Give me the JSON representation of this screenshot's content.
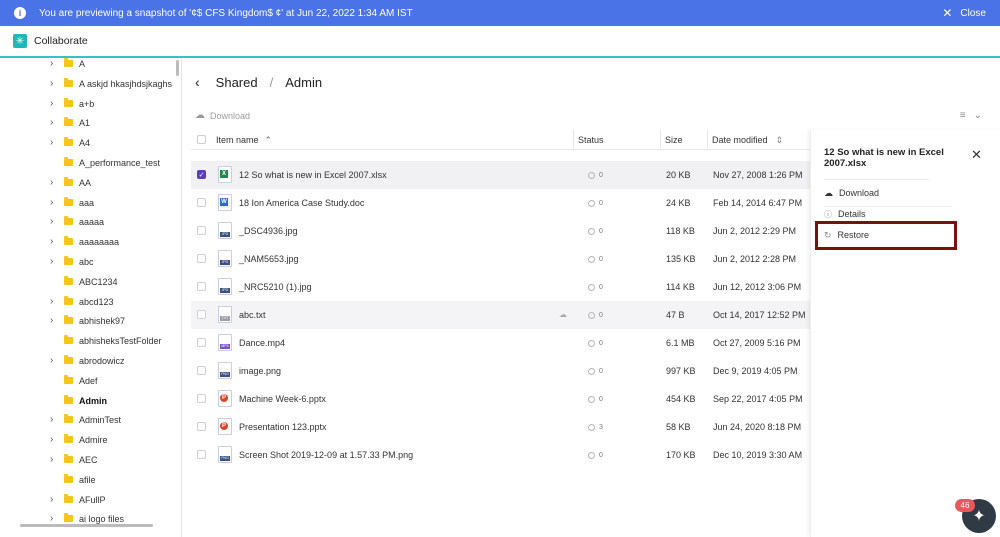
{
  "banner": {
    "message": "You are previewing a snapshot of '¢$ CFS Kingdom$ ¢' at Jun 22, 2022 1:34 AM IST",
    "close_label": "Close"
  },
  "app": {
    "title": "Collaborate"
  },
  "tree": {
    "items": [
      {
        "label": "A",
        "expandable": true
      },
      {
        "label": "A askjd hkasjhdsjkaghs",
        "expandable": true
      },
      {
        "label": "a+b",
        "expandable": true
      },
      {
        "label": "A1",
        "expandable": true
      },
      {
        "label": "A4",
        "expandable": true
      },
      {
        "label": "A_performance_test",
        "expandable": false
      },
      {
        "label": "AA",
        "expandable": true
      },
      {
        "label": "aaa",
        "expandable": true
      },
      {
        "label": "aaaaa",
        "expandable": true
      },
      {
        "label": "aaaaaaaa",
        "expandable": true
      },
      {
        "label": "abc",
        "expandable": true
      },
      {
        "label": "ABC1234",
        "expandable": false
      },
      {
        "label": "abcd123",
        "expandable": true
      },
      {
        "label": "abhishek97",
        "expandable": true
      },
      {
        "label": "abhisheksTestFolder",
        "expandable": false
      },
      {
        "label": "abrodowicz",
        "expandable": true
      },
      {
        "label": "Adef",
        "expandable": false
      },
      {
        "label": "Admin",
        "expandable": false,
        "active": true
      },
      {
        "label": "AdminTest",
        "expandable": true
      },
      {
        "label": "Admire",
        "expandable": true
      },
      {
        "label": "AEC",
        "expandable": true
      },
      {
        "label": "afile",
        "expandable": false
      },
      {
        "label": "AFullP",
        "expandable": true
      },
      {
        "label": "ai logo files",
        "expandable": true
      }
    ]
  },
  "breadcrumb": {
    "root": "Shared",
    "separator": "/",
    "current": "Admin"
  },
  "toolbar": {
    "download_label": "Download"
  },
  "table": {
    "headers": {
      "name": "Item name",
      "status": "Status",
      "size": "Size",
      "date": "Date modified"
    },
    "rows": [
      {
        "name": "12 So what is new in Excel 2007.xlsx",
        "type": "xls",
        "tag": "",
        "status": "0",
        "size": "20 KB",
        "date": "Nov 27, 2008 1:26 PM",
        "selected": true
      },
      {
        "name": "18 Ion America Case Study.doc",
        "type": "doc",
        "tag": "",
        "status": "0",
        "size": "24 KB",
        "date": "Feb 14, 2014 6:47 PM"
      },
      {
        "name": "_DSC4936.jpg",
        "type": "jpg",
        "tag": "JPG",
        "status": "0",
        "size": "118 KB",
        "date": "Jun 2, 2012 2:29 PM"
      },
      {
        "name": "_NAM5653.jpg",
        "type": "jpg",
        "tag": "JPG",
        "status": "0",
        "size": "135 KB",
        "date": "Jun 2, 2012 2:28 PM"
      },
      {
        "name": "_NRC5210 (1).jpg",
        "type": "jpg",
        "tag": "JPG",
        "status": "0",
        "size": "114 KB",
        "date": "Jun 12, 2012 3:06 PM"
      },
      {
        "name": "abc.txt",
        "type": "txt",
        "tag": "TXT",
        "status": "0",
        "size": "47 B",
        "date": "Oct 14, 2017 12:52 PM",
        "hover": true
      },
      {
        "name": "Dance.mp4",
        "type": "mp4",
        "tag": "MP4",
        "status": "0",
        "size": "6.1 MB",
        "date": "Oct 27, 2009 5:16 PM"
      },
      {
        "name": "image.png",
        "type": "png",
        "tag": "PNG",
        "status": "0",
        "size": "997 KB",
        "date": "Dec 9, 2019 4:05 PM"
      },
      {
        "name": "Machine Week-6.pptx",
        "type": "ppt",
        "tag": "",
        "status": "0",
        "size": "454 KB",
        "date": "Sep 22, 2017 4:05 PM"
      },
      {
        "name": "Presentation 123.pptx",
        "type": "ppt",
        "tag": "",
        "status": "3",
        "size": "58 KB",
        "date": "Jun 24, 2020 8:18 PM"
      },
      {
        "name": "Screen Shot 2019-12-09 at 1.57.33 PM.png",
        "type": "png",
        "tag": "PNG",
        "status": "0",
        "size": "170 KB",
        "date": "Dec 10, 2019 3:30 AM"
      }
    ]
  },
  "panel": {
    "title": "12 So what is new in Excel 2007.xlsx",
    "download_label": "Download",
    "details_label": "Details",
    "restore_label": "Restore"
  },
  "chat": {
    "badge": "46"
  }
}
